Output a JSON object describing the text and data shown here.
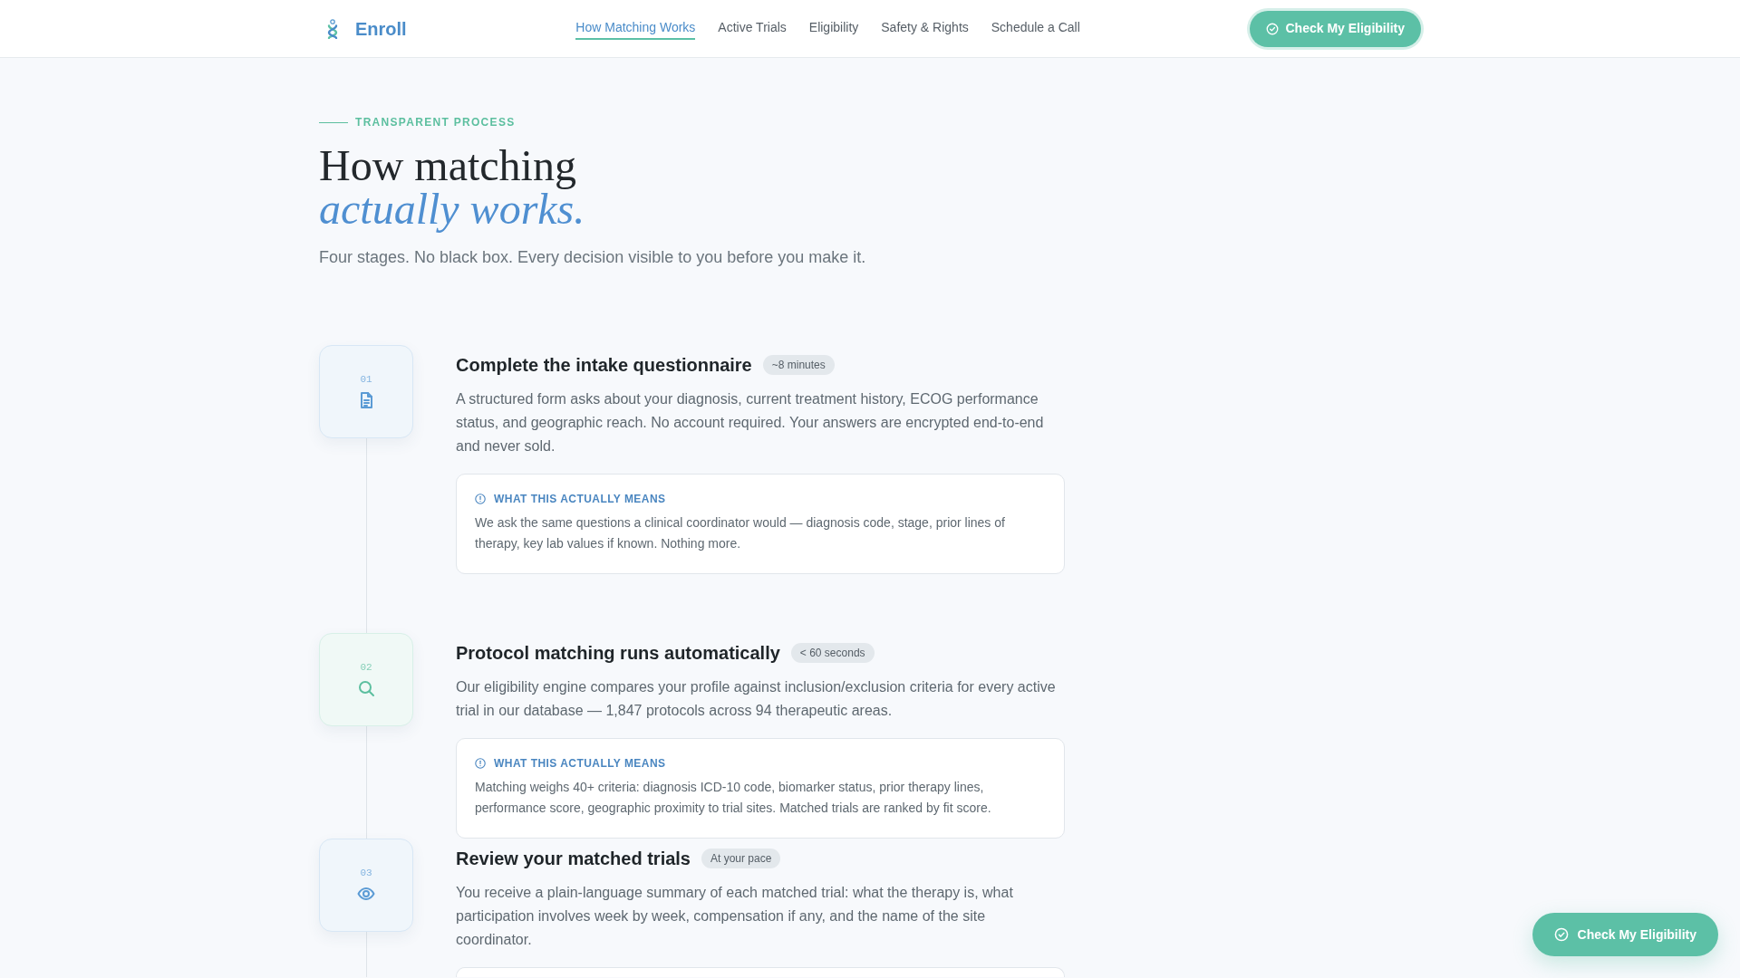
{
  "nav": {
    "brand": "Enroll",
    "links": [
      {
        "label": "How Matching Works",
        "selected": true
      },
      {
        "label": "Active Trials",
        "selected": false
      },
      {
        "label": "Eligibility",
        "selected": false
      },
      {
        "label": "Safety & Rights",
        "selected": false
      },
      {
        "label": "Schedule a Call",
        "selected": false
      }
    ],
    "cta": "Check My Eligibility"
  },
  "hero": {
    "eyebrow": "TRANSPARENT PROCESS",
    "title_line_1": "How matching",
    "title_line_2": "actually works.",
    "subtitle": "Four stages. No black box. Every decision visible to you before you make it."
  },
  "steps": [
    {
      "number": "01",
      "kind": "document",
      "color": "#5b9bd5",
      "title": "Complete the intake questionnaire",
      "badge": "~8 minutes",
      "description": "A structured form asks about your diagnosis, current treatment history, ECOG performance status, and geographic reach. No account required. Your answers are encrypted end-to-end and never sold.",
      "note": {
        "cut_off": false,
        "heading": "WHAT THIS ACTUALLY MEANS",
        "text": "We ask the same questions a clinical coordinator would — diagnosis code, stage, prior lines of therapy, key lab values if known. Nothing more."
      }
    },
    {
      "number": "02",
      "kind": "search",
      "color": "#5cbf9f",
      "title": "Protocol matching runs automatically",
      "badge": "< 60 seconds",
      "description": "Our eligibility engine compares your profile against inclusion/exclusion criteria for every active trial in our database — 1,847 protocols across 94 therapeutic areas.",
      "note": {
        "cut_off": false,
        "heading": "WHAT THIS ACTUALLY MEANS",
        "text": "Matching weighs 40+ criteria: diagnosis ICD-10 code, biomarker status, prior therapy lines, performance score, geographic proximity to trial sites. Matched trials are ranked by fit score."
      }
    },
    {
      "number": "03",
      "kind": "eye",
      "color": "#5b9bd5",
      "title": "Review your matched trials",
      "badge": "At your pace",
      "description": "You receive a plain-language summary of each matched trial: what the therapy is, what participation involves week by week, compensation if any, and the name of the site coordinator.",
      "note": {
        "cut_off": true
      }
    }
  ],
  "floating_button": "Check My Eligibility"
}
